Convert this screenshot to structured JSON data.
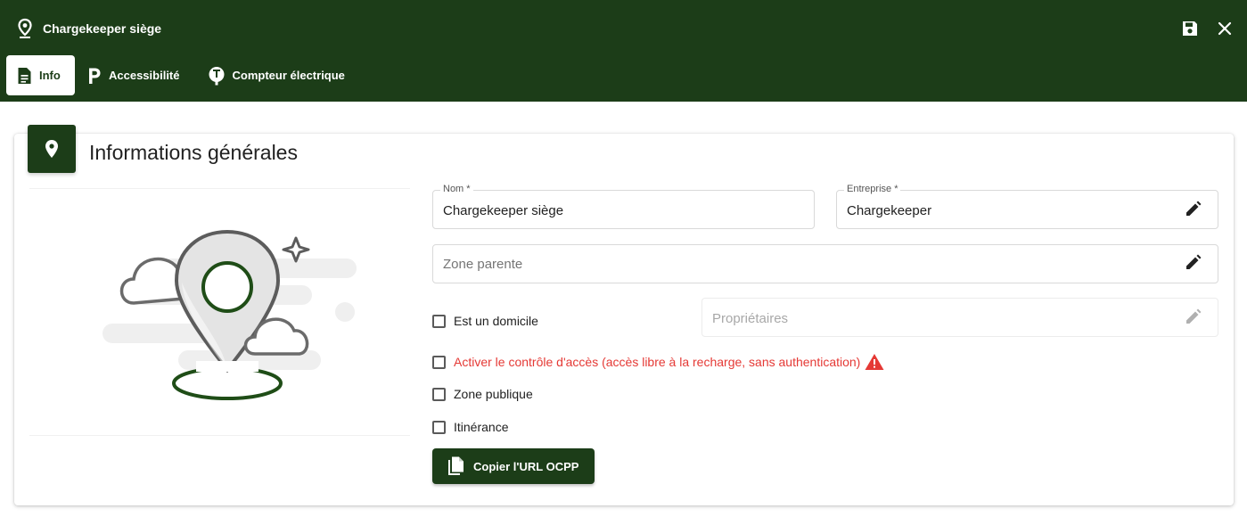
{
  "window": {
    "title": "Chargekeeper siège"
  },
  "header_actions": {
    "save_icon": "save-icon",
    "close_icon": "close-icon"
  },
  "tabs": [
    {
      "label": "Info",
      "icon": "document-icon",
      "active": true
    },
    {
      "label": "Accessibilité",
      "icon": "parking-icon",
      "active": false
    },
    {
      "label": "Compteur électrique",
      "icon": "electric-meter-icon",
      "active": false
    }
  ],
  "section": {
    "title": "Informations générales",
    "icon": "location-pin-icon"
  },
  "form": {
    "nom": {
      "label": "Nom *",
      "value": "Chargekeeper siège"
    },
    "entreprise": {
      "label": "Entreprise *",
      "value": "Chargekeeper"
    },
    "zone_parente": {
      "placeholder": "Zone parente"
    },
    "proprietaires": {
      "placeholder": "Propriétaires"
    },
    "checkboxes": {
      "domicile": "Est un domicile",
      "controle_acces": "Activer le contrôle d'accès (accès libre à la recharge, sans authentication)",
      "zone_publique": "Zone publique",
      "itinerance": "Itinérance"
    },
    "copy_button": "Copier l'URL OCPP"
  },
  "colors": {
    "brand": "#1c3d18",
    "warning": "#e53935"
  }
}
